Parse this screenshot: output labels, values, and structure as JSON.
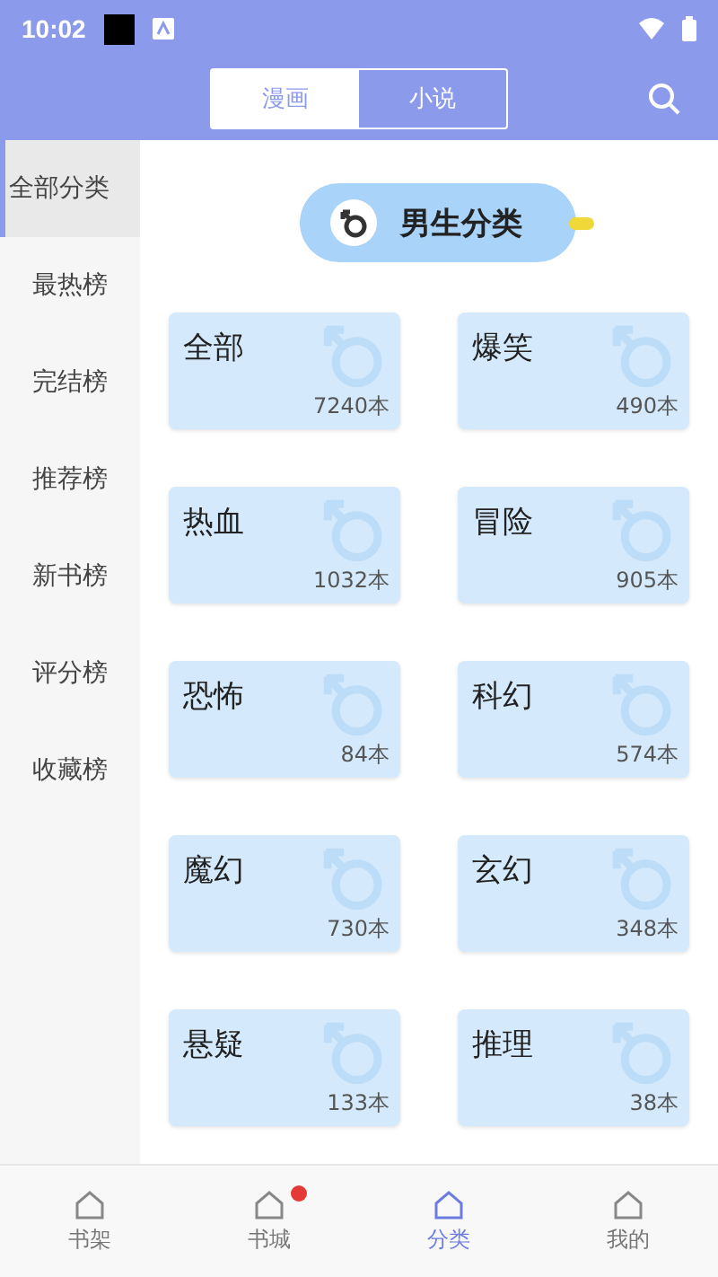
{
  "status_bar": {
    "time": "10:02"
  },
  "tabs": [
    {
      "label": "漫画",
      "selected": true
    },
    {
      "label": "小说",
      "selected": false
    }
  ],
  "sidebar": {
    "items": [
      {
        "label": "全部分类",
        "selected": true
      },
      {
        "label": "最热榜",
        "selected": false
      },
      {
        "label": "完结榜",
        "selected": false
      },
      {
        "label": "推荐榜",
        "selected": false
      },
      {
        "label": "新书榜",
        "selected": false
      },
      {
        "label": "评分榜",
        "selected": false
      },
      {
        "label": "收藏榜",
        "selected": false
      }
    ]
  },
  "section_title": "男生分类",
  "categories": [
    {
      "name": "全部",
      "count": "7240本"
    },
    {
      "name": "爆笑",
      "count": "490本"
    },
    {
      "name": "热血",
      "count": "1032本"
    },
    {
      "name": "冒险",
      "count": "905本"
    },
    {
      "name": "恐怖",
      "count": "84本"
    },
    {
      "name": "科幻",
      "count": "574本"
    },
    {
      "name": "魔幻",
      "count": "730本"
    },
    {
      "name": "玄幻",
      "count": "348本"
    },
    {
      "name": "悬疑",
      "count": "133本"
    },
    {
      "name": "推理",
      "count": "38本"
    }
  ],
  "bottom_nav": [
    {
      "label": "书架",
      "selected": false,
      "badge": false
    },
    {
      "label": "书城",
      "selected": false,
      "badge": true
    },
    {
      "label": "分类",
      "selected": true,
      "badge": false
    },
    {
      "label": "我的",
      "selected": false,
      "badge": false
    }
  ]
}
